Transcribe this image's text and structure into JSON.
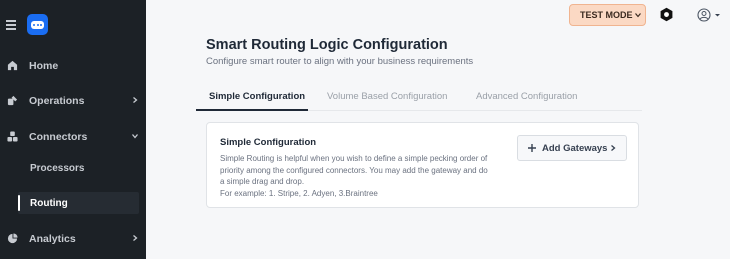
{
  "sidebar": {
    "items": [
      {
        "label": "Home",
        "icon": "home-icon"
      },
      {
        "label": "Operations",
        "icon": "operations-icon"
      },
      {
        "label": "Connectors",
        "icon": "connectors-icon"
      },
      {
        "label": "Analytics",
        "icon": "analytics-icon"
      }
    ],
    "sub_items": [
      {
        "label": "Processors"
      },
      {
        "label": "Routing"
      }
    ]
  },
  "header": {
    "mode_label": "TEST MODE"
  },
  "main": {
    "title": "Smart Routing Logic Configuration",
    "subtitle": "Configure smart router to align with your business requirements",
    "tabs": [
      {
        "label": "Simple Configuration"
      },
      {
        "label": "Volume Based Configuration"
      },
      {
        "label": "Advanced Configuration"
      }
    ],
    "card": {
      "title": "Simple Configuration",
      "desc_lines": [
        "Simple Routing is helpful when you wish to define a simple pecking order of",
        "priority among the configured connectors. You may add the gateway and do",
        "a simple drag and drop.",
        "For example: 1. Stripe, 2. Adyen, 3.Braintree"
      ],
      "button_label": "Add Gateways"
    }
  },
  "colors": {
    "sidebar_bg": "#1c2126",
    "accent_blue": "#1a6df2",
    "test_mode_bg": "#fbd9c4"
  }
}
